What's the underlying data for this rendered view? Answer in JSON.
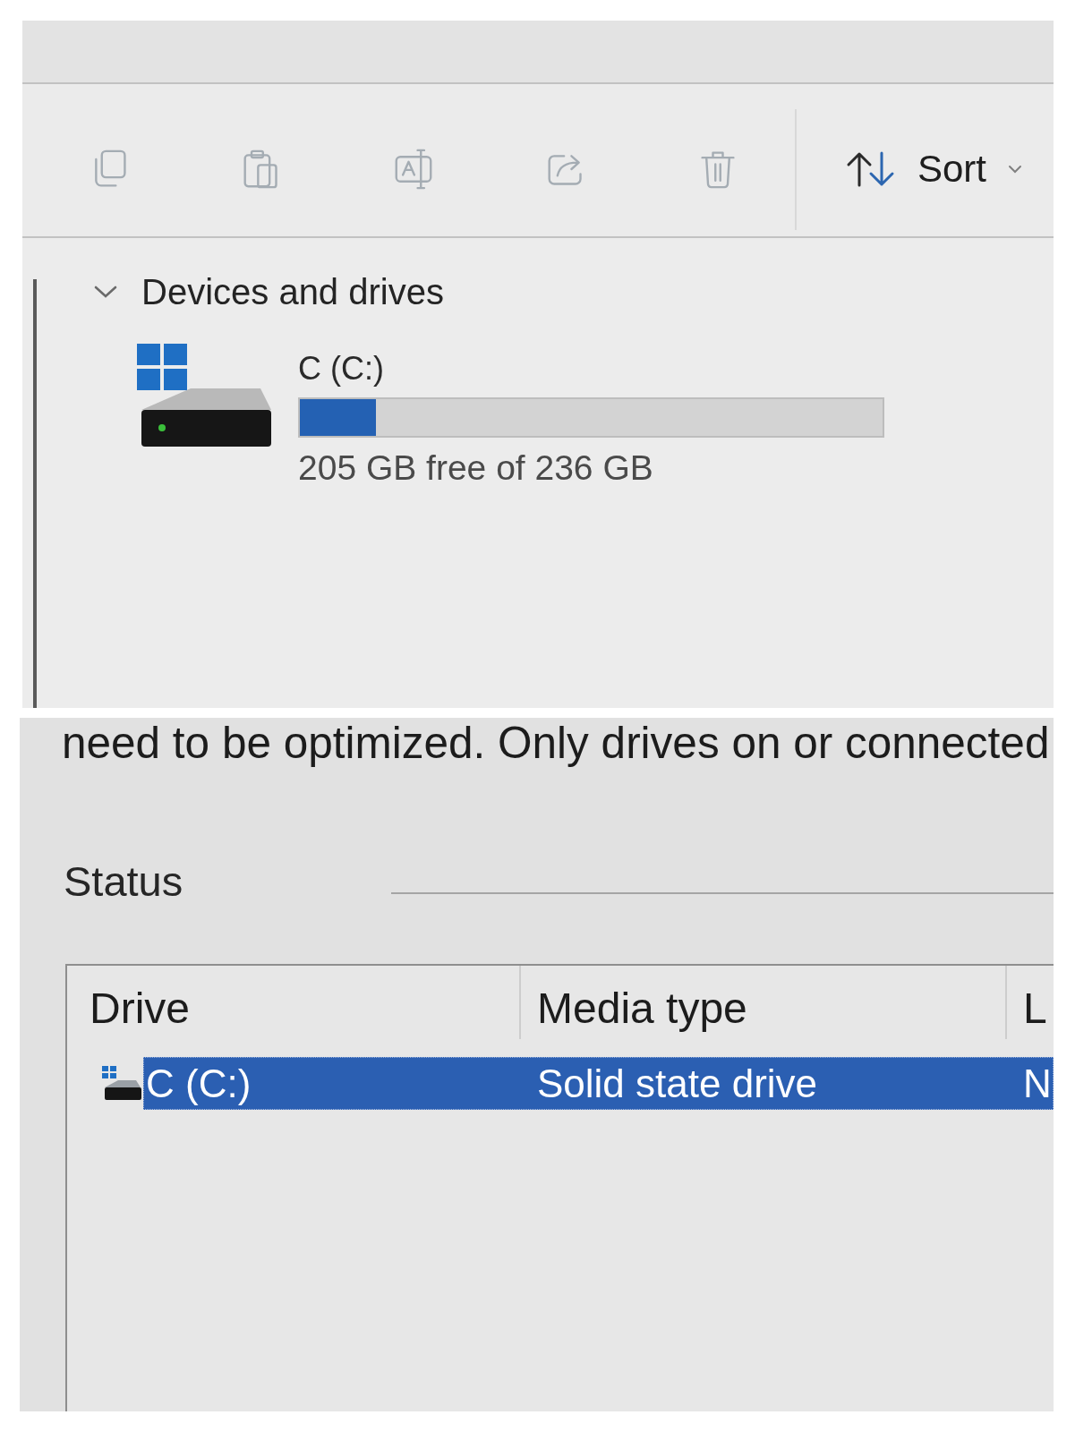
{
  "toolbar": {
    "buttons": [
      {
        "kind": "copy",
        "disabled": true
      },
      {
        "kind": "paste",
        "disabled": true
      },
      {
        "kind": "rename",
        "disabled": true
      },
      {
        "kind": "share",
        "disabled": true
      },
      {
        "kind": "delete",
        "disabled": true
      }
    ],
    "sort": {
      "label": "Sort"
    }
  },
  "section": {
    "title": "Devices and drives",
    "expanded": true,
    "drives": [
      {
        "name": "C (C:)",
        "level": 0.13,
        "space": "205 GB free of 236 GB"
      }
    ]
  },
  "optimize_text": "need to be optimized. Only drives on or connected",
  "status": {
    "title": "Status",
    "table": {
      "columns": [
        "Drive",
        "Media type",
        "L"
      ],
      "rows": [
        {
          "cells": [
            "C (C:)",
            "Solid state drive",
            "N"
          ],
          "selected": true
        }
      ]
    }
  }
}
